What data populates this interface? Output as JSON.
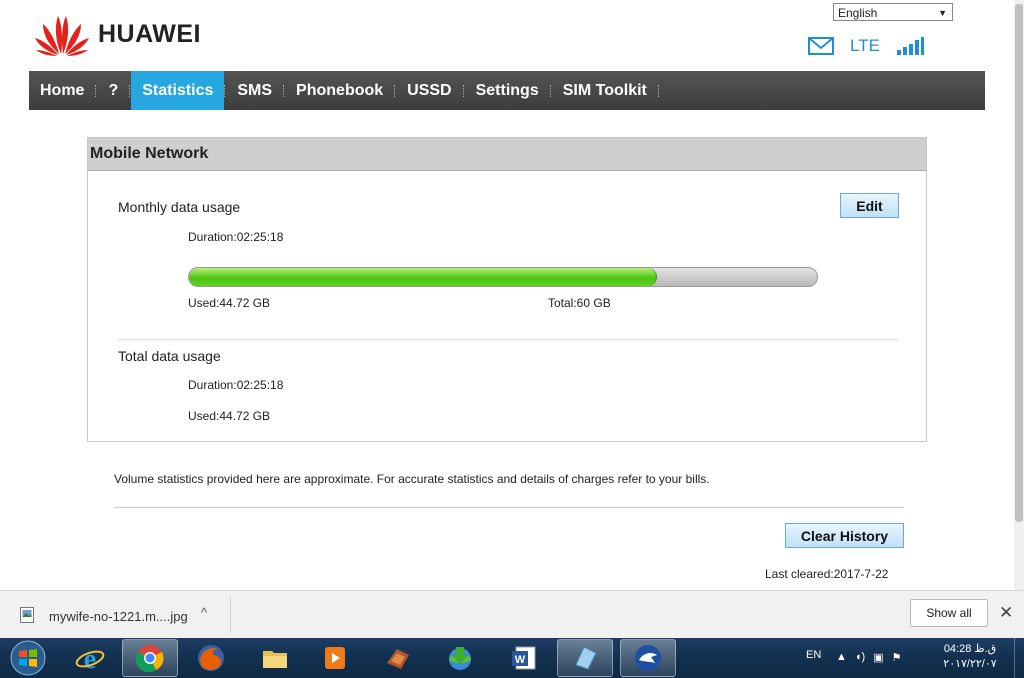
{
  "brand": {
    "name": "HUAWEI"
  },
  "language": {
    "selected": "English"
  },
  "status": {
    "network": "LTE"
  },
  "nav": {
    "items": [
      {
        "label": "Home"
      },
      {
        "label": "?"
      },
      {
        "label": "Statistics"
      },
      {
        "label": "SMS"
      },
      {
        "label": "Phonebook"
      },
      {
        "label": "USSD"
      },
      {
        "label": "Settings"
      },
      {
        "label": "SIM Toolkit"
      }
    ],
    "active": "Statistics"
  },
  "panel": {
    "title": "Mobile Network",
    "monthly": {
      "label": "Monthly data usage",
      "edit_label": "Edit",
      "duration": "Duration:02:25:18",
      "used": "Used:44.72 GB",
      "total": "Total:60 GB",
      "progress_fraction": 0.745
    },
    "total_usage": {
      "label": "Total data usage",
      "duration": "Duration:02:25:18",
      "used": "Used:44.72 GB"
    }
  },
  "notice": "Volume statistics provided here are approximate. For accurate statistics and details of charges refer to your bills.",
  "clear_history_label": "Clear History",
  "last_cleared": "Last cleared:2017-7-22",
  "download": {
    "filename": "mywife-no-1221.m....jpg",
    "show_all": "Show all"
  },
  "taskbar": {
    "lang": "EN",
    "time": "ق.ظ 04:28",
    "date": "٢٠١٧/٢٢/٠٧"
  },
  "colors": {
    "nav_bg": "#444444",
    "nav_active": "#26a7e0",
    "progress_green": "#4cc414",
    "lte_blue": "#1e8fd6",
    "logo_red": "#e0241d"
  }
}
